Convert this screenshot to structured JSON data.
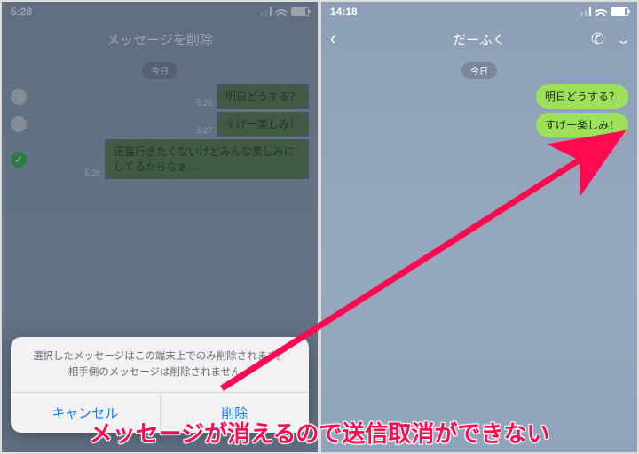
{
  "left": {
    "status_time": "5:28",
    "nav_title": "メッセージを削除",
    "date_label": "今日",
    "msg1": {
      "text": "明日どうする？",
      "time": "5:26"
    },
    "msg2": {
      "text": "すげー楽しみ！",
      "time": "5:27"
    },
    "msg3": {
      "text": "正直行きたくないけどみんな楽しみにしてるからなぁ…",
      "time": "5:28"
    },
    "sheet_line1": "選択したメッセージはこの端末上でのみ削除されます。",
    "sheet_line2": "相手側のメッセージは削除されません。",
    "cancel": "キャンセル",
    "delete": "削除"
  },
  "right": {
    "status_time": "14:18",
    "nav_title": "だーふく",
    "date_label": "今日",
    "msg1": {
      "text": "明日どうする？"
    },
    "msg2": {
      "text": "すげー楽しみ！"
    }
  },
  "caption": "メッセージが消えるので送信取消ができない"
}
